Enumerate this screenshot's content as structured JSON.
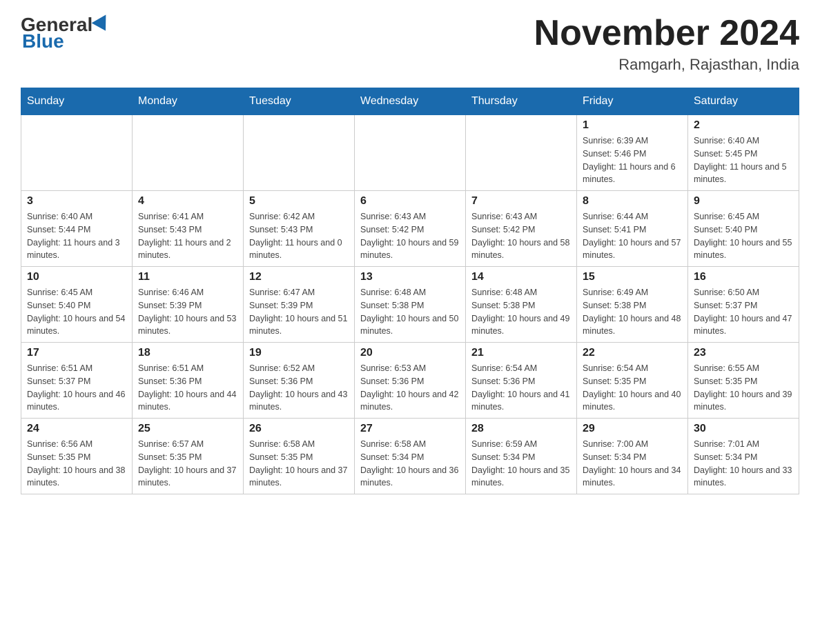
{
  "header": {
    "logo_general": "General",
    "logo_blue": "Blue",
    "month_title": "November 2024",
    "location": "Ramgarh, Rajasthan, India"
  },
  "days_of_week": [
    "Sunday",
    "Monday",
    "Tuesday",
    "Wednesday",
    "Thursday",
    "Friday",
    "Saturday"
  ],
  "weeks": [
    [
      {
        "day": "",
        "info": ""
      },
      {
        "day": "",
        "info": ""
      },
      {
        "day": "",
        "info": ""
      },
      {
        "day": "",
        "info": ""
      },
      {
        "day": "",
        "info": ""
      },
      {
        "day": "1",
        "info": "Sunrise: 6:39 AM\nSunset: 5:46 PM\nDaylight: 11 hours and 6 minutes."
      },
      {
        "day": "2",
        "info": "Sunrise: 6:40 AM\nSunset: 5:45 PM\nDaylight: 11 hours and 5 minutes."
      }
    ],
    [
      {
        "day": "3",
        "info": "Sunrise: 6:40 AM\nSunset: 5:44 PM\nDaylight: 11 hours and 3 minutes."
      },
      {
        "day": "4",
        "info": "Sunrise: 6:41 AM\nSunset: 5:43 PM\nDaylight: 11 hours and 2 minutes."
      },
      {
        "day": "5",
        "info": "Sunrise: 6:42 AM\nSunset: 5:43 PM\nDaylight: 11 hours and 0 minutes."
      },
      {
        "day": "6",
        "info": "Sunrise: 6:43 AM\nSunset: 5:42 PM\nDaylight: 10 hours and 59 minutes."
      },
      {
        "day": "7",
        "info": "Sunrise: 6:43 AM\nSunset: 5:42 PM\nDaylight: 10 hours and 58 minutes."
      },
      {
        "day": "8",
        "info": "Sunrise: 6:44 AM\nSunset: 5:41 PM\nDaylight: 10 hours and 57 minutes."
      },
      {
        "day": "9",
        "info": "Sunrise: 6:45 AM\nSunset: 5:40 PM\nDaylight: 10 hours and 55 minutes."
      }
    ],
    [
      {
        "day": "10",
        "info": "Sunrise: 6:45 AM\nSunset: 5:40 PM\nDaylight: 10 hours and 54 minutes."
      },
      {
        "day": "11",
        "info": "Sunrise: 6:46 AM\nSunset: 5:39 PM\nDaylight: 10 hours and 53 minutes."
      },
      {
        "day": "12",
        "info": "Sunrise: 6:47 AM\nSunset: 5:39 PM\nDaylight: 10 hours and 51 minutes."
      },
      {
        "day": "13",
        "info": "Sunrise: 6:48 AM\nSunset: 5:38 PM\nDaylight: 10 hours and 50 minutes."
      },
      {
        "day": "14",
        "info": "Sunrise: 6:48 AM\nSunset: 5:38 PM\nDaylight: 10 hours and 49 minutes."
      },
      {
        "day": "15",
        "info": "Sunrise: 6:49 AM\nSunset: 5:38 PM\nDaylight: 10 hours and 48 minutes."
      },
      {
        "day": "16",
        "info": "Sunrise: 6:50 AM\nSunset: 5:37 PM\nDaylight: 10 hours and 47 minutes."
      }
    ],
    [
      {
        "day": "17",
        "info": "Sunrise: 6:51 AM\nSunset: 5:37 PM\nDaylight: 10 hours and 46 minutes."
      },
      {
        "day": "18",
        "info": "Sunrise: 6:51 AM\nSunset: 5:36 PM\nDaylight: 10 hours and 44 minutes."
      },
      {
        "day": "19",
        "info": "Sunrise: 6:52 AM\nSunset: 5:36 PM\nDaylight: 10 hours and 43 minutes."
      },
      {
        "day": "20",
        "info": "Sunrise: 6:53 AM\nSunset: 5:36 PM\nDaylight: 10 hours and 42 minutes."
      },
      {
        "day": "21",
        "info": "Sunrise: 6:54 AM\nSunset: 5:36 PM\nDaylight: 10 hours and 41 minutes."
      },
      {
        "day": "22",
        "info": "Sunrise: 6:54 AM\nSunset: 5:35 PM\nDaylight: 10 hours and 40 minutes."
      },
      {
        "day": "23",
        "info": "Sunrise: 6:55 AM\nSunset: 5:35 PM\nDaylight: 10 hours and 39 minutes."
      }
    ],
    [
      {
        "day": "24",
        "info": "Sunrise: 6:56 AM\nSunset: 5:35 PM\nDaylight: 10 hours and 38 minutes."
      },
      {
        "day": "25",
        "info": "Sunrise: 6:57 AM\nSunset: 5:35 PM\nDaylight: 10 hours and 37 minutes."
      },
      {
        "day": "26",
        "info": "Sunrise: 6:58 AM\nSunset: 5:35 PM\nDaylight: 10 hours and 37 minutes."
      },
      {
        "day": "27",
        "info": "Sunrise: 6:58 AM\nSunset: 5:34 PM\nDaylight: 10 hours and 36 minutes."
      },
      {
        "day": "28",
        "info": "Sunrise: 6:59 AM\nSunset: 5:34 PM\nDaylight: 10 hours and 35 minutes."
      },
      {
        "day": "29",
        "info": "Sunrise: 7:00 AM\nSunset: 5:34 PM\nDaylight: 10 hours and 34 minutes."
      },
      {
        "day": "30",
        "info": "Sunrise: 7:01 AM\nSunset: 5:34 PM\nDaylight: 10 hours and 33 minutes."
      }
    ]
  ]
}
